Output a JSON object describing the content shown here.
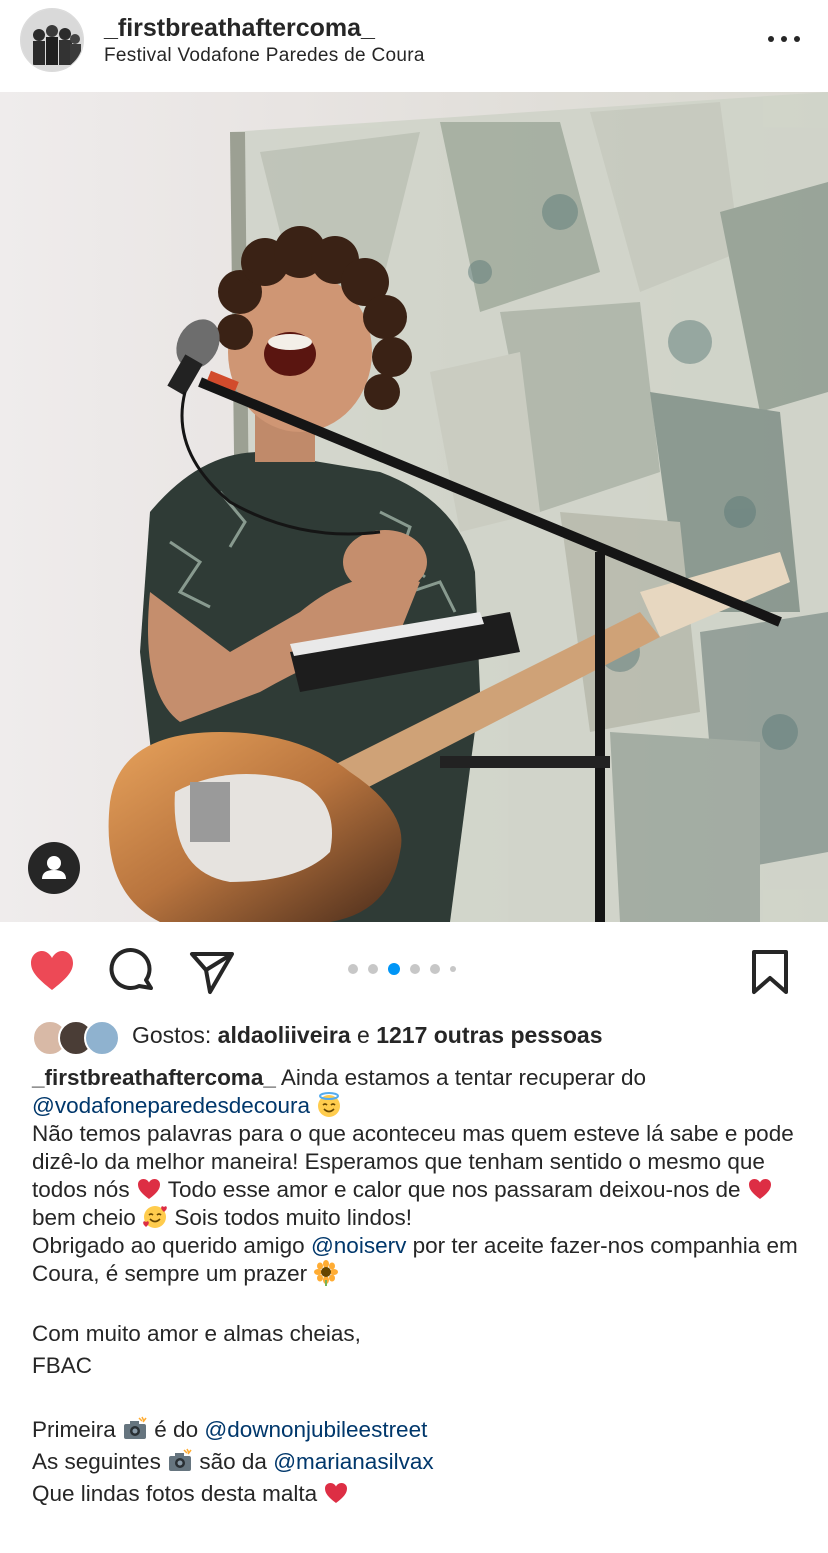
{
  "post": {
    "username": "_firstbreathaftercoma_",
    "location": "Festival Vodafone Paredes de Coura"
  },
  "actions": {
    "liked": true,
    "carousel_count": 6,
    "carousel_active_index": 2,
    "like_color": "#ed4956",
    "active_dot_color": "#0095f6"
  },
  "likes": {
    "prefix": "Gostos:",
    "first_liker": "aldaoliiveira",
    "conjunction": "e",
    "others": "1217 outras pessoas"
  },
  "caption": {
    "user": "_firstbreathaftercoma_",
    "l1": "Ainda estamos a tentar recuperar do",
    "mention1": "@vodafoneparedesdecoura",
    "p2a": "Não temos palavras para o que aconteceu mas quem esteve lá sabe e pode dizê-lo da melhor maneira! Esperamos que tenham sentido o mesmo que todos nós",
    "p2b": "Todo esse amor e calor que nos passaram deixou-nos de",
    "p2c": "bem cheio",
    "p2d": "Sois todos muito lindos!",
    "p3a": "Obrigado ao querido amigo",
    "mention2": "@noiserv",
    "p3b": "por ter aceite fazer-nos companhia em Coura, é sempre um prazer",
    "sign1": "Com muito amor e almas cheias,",
    "sign2": "FBAC",
    "c1a": "Primeira",
    "c1b": "é do",
    "mention3": "@downonjubileestreet",
    "c2a": "As seguintes",
    "c2b": "são da",
    "mention4": "@marianasilvax",
    "c3": "Que lindas fotos desta malta"
  }
}
